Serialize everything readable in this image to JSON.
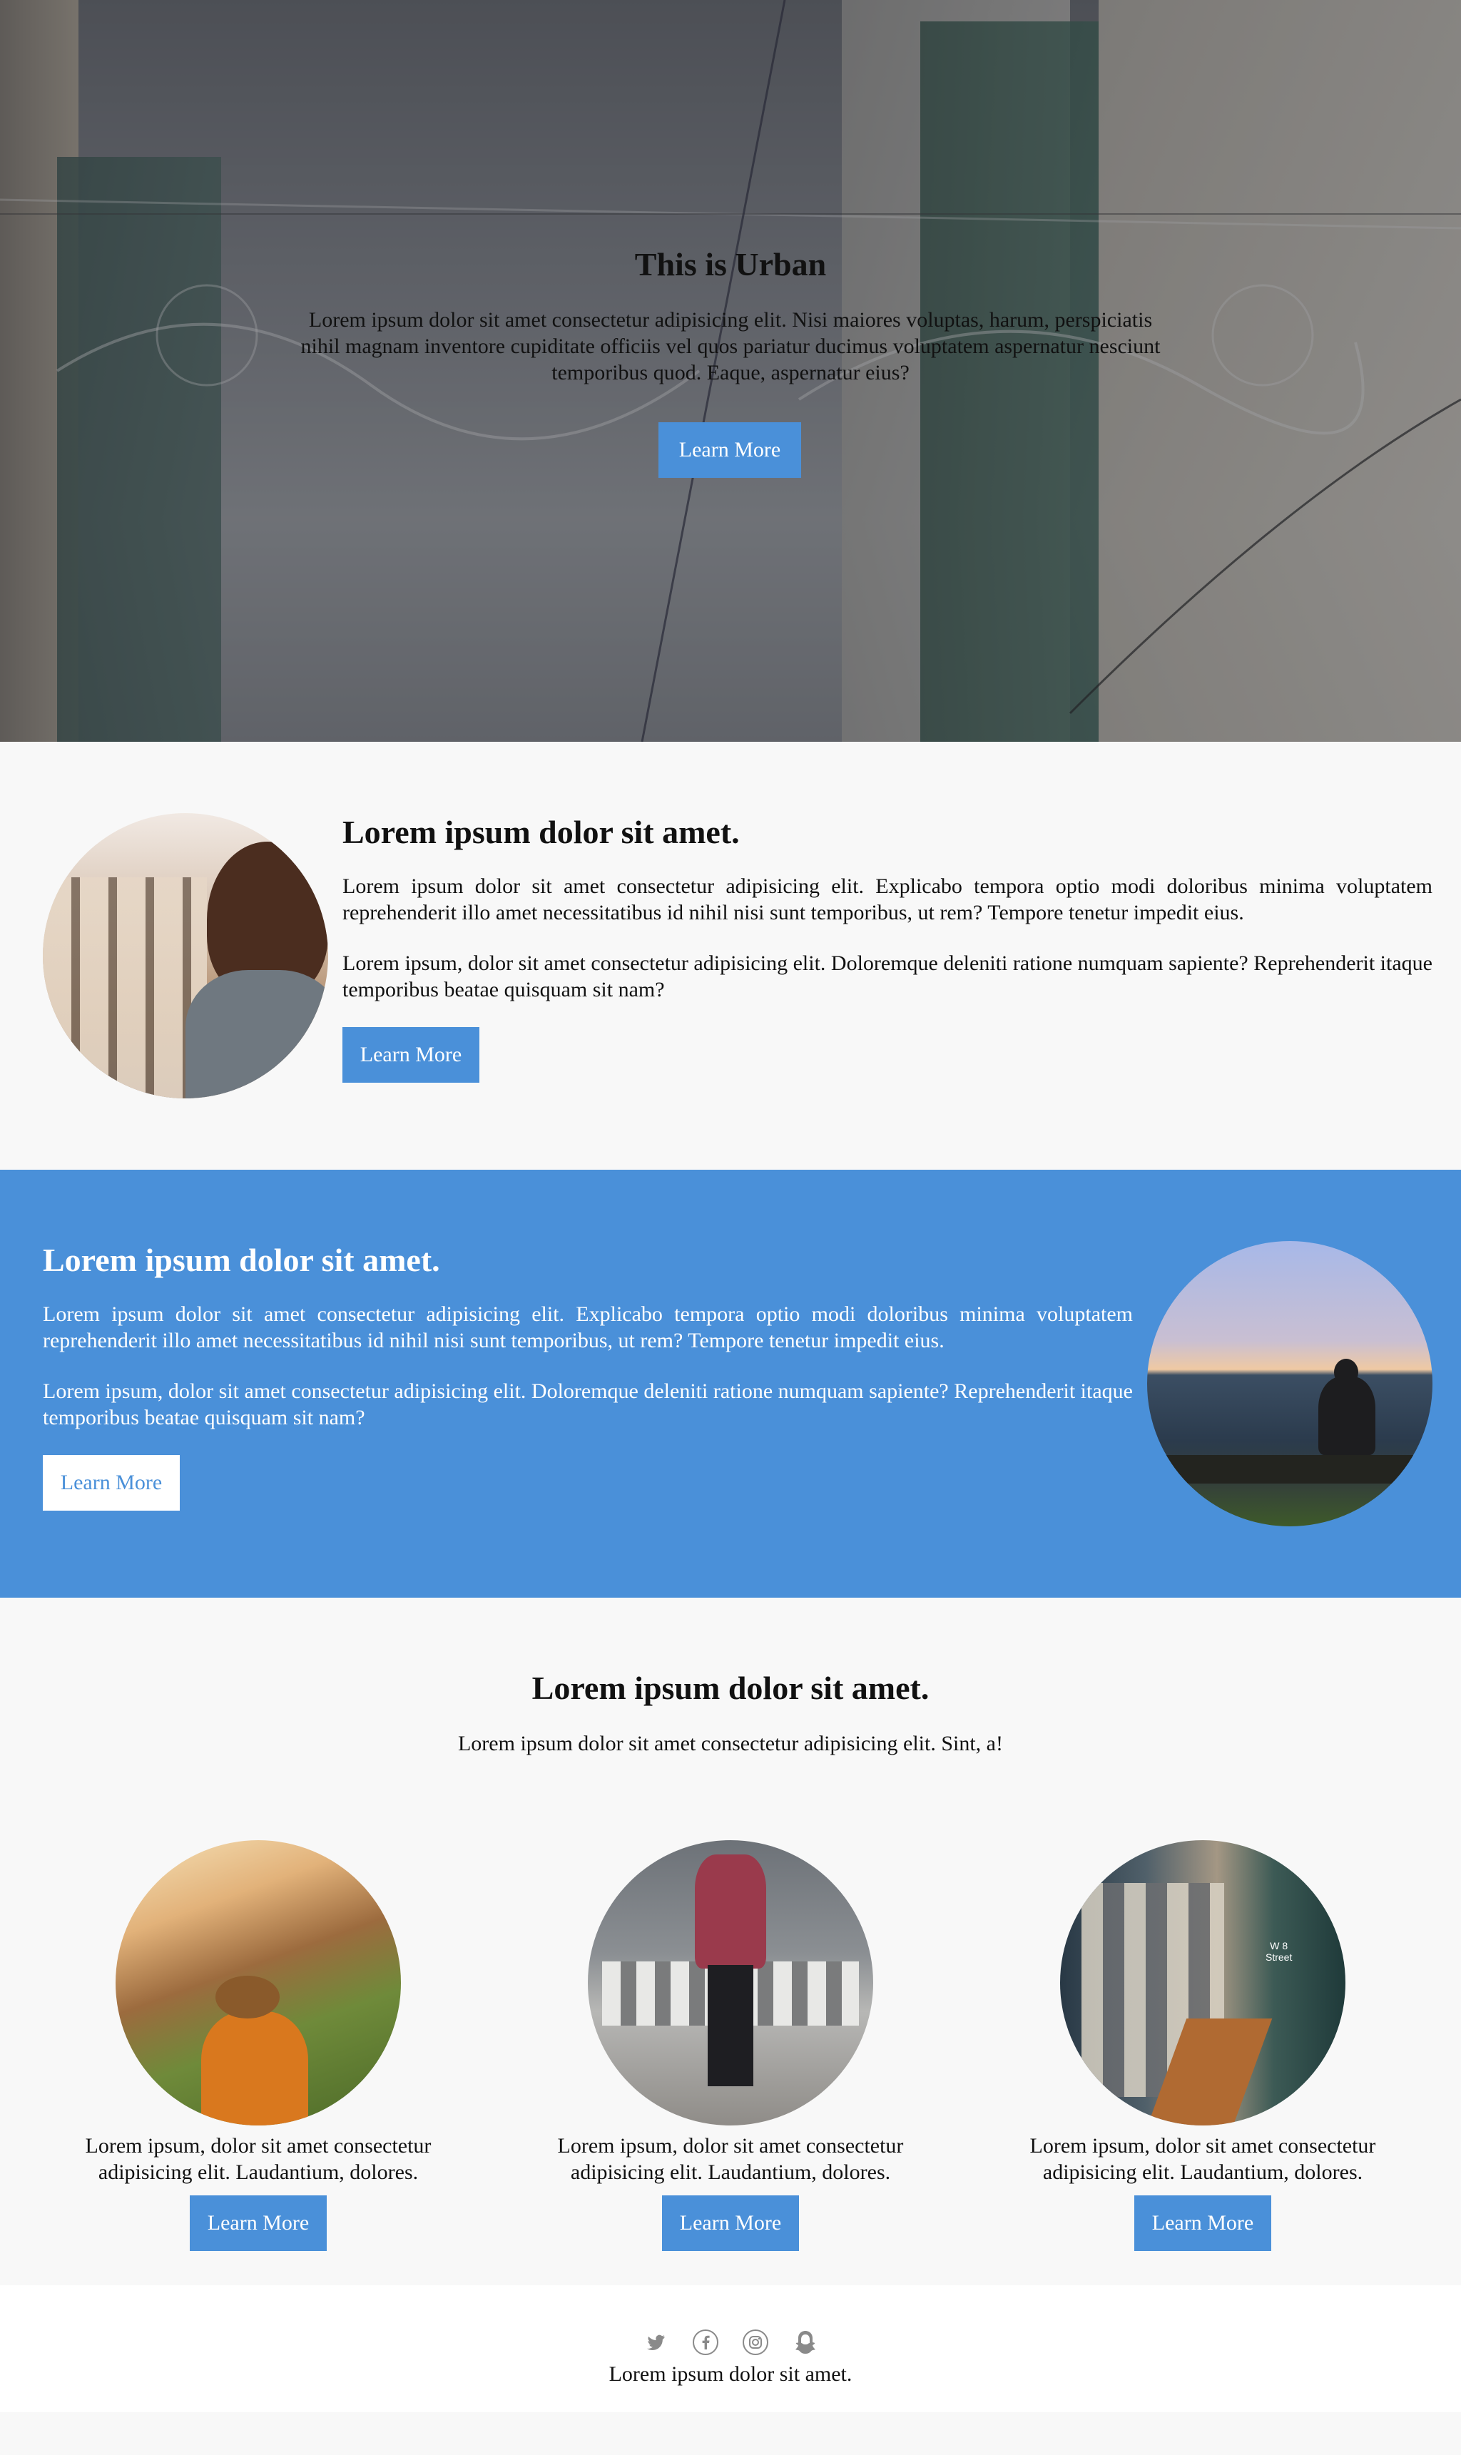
{
  "hero": {
    "title": "This is Urban",
    "text": "Lorem ipsum dolor sit amet consectetur adipisicing elit. Nisi maiores voluptas, harum, perspiciatis nihil magnam inventore cupiditate officiis vel quos pariatur ducimus voluptatem aspernatur nesciunt temporibus quod. Eaque, aspernatur eius?",
    "button": "Learn More"
  },
  "section1": {
    "title": "Lorem ipsum dolor sit amet.",
    "para1": "Lorem ipsum dolor sit amet consectetur adipisicing elit. Explicabo tempora optio modi doloribus minima voluptatem reprehenderit illo amet necessitatibus id nihil nisi sunt temporibus, ut rem? Tempore tenetur impedit eius.",
    "para2": "Lorem ipsum, dolor sit amet consectetur adipisicing elit. Doloremque deleniti ratione numquam sapiente? Reprehenderit itaque temporibus beatae quisquam sit nam?",
    "button": "Learn More"
  },
  "section2": {
    "title": "Lorem ipsum dolor sit amet.",
    "para1": "Lorem ipsum dolor sit amet consectetur adipisicing elit. Explicabo tempora optio modi doloribus minima voluptatem reprehenderit illo amet necessitatibus id nihil nisi sunt temporibus, ut rem? Tempore tenetur impedit eius.",
    "para2": "Lorem ipsum, dolor sit amet consectetur adipisicing elit. Doloremque deleniti ratione numquam sapiente? Reprehenderit itaque temporibus beatae quisquam sit nam?",
    "button": "Learn More"
  },
  "section3": {
    "title": "Lorem ipsum dolor sit amet.",
    "subtitle": "Lorem ipsum dolor sit amet consectetur adipisicing elit. Sint, a!",
    "cards": [
      {
        "text": "Lorem ipsum, dolor sit amet consectetur adipisicing elit. Laudantium, dolores.",
        "button": "Learn More"
      },
      {
        "text": "Lorem ipsum, dolor sit amet consectetur adipisicing elit. Laudantium, dolores.",
        "button": "Learn More"
      },
      {
        "text": "Lorem ipsum, dolor sit amet consectetur adipisicing elit. Laudantium, dolores.",
        "button": "Learn More"
      }
    ],
    "card3_sign": "W 8\nStreet"
  },
  "footer": {
    "text": "Lorem ipsum dolor sit amet.",
    "icons": [
      "twitter-icon",
      "facebook-icon",
      "instagram-icon",
      "snapchat-icon"
    ]
  },
  "colors": {
    "accent": "#4a90d9",
    "background": "#f8f8f8"
  }
}
